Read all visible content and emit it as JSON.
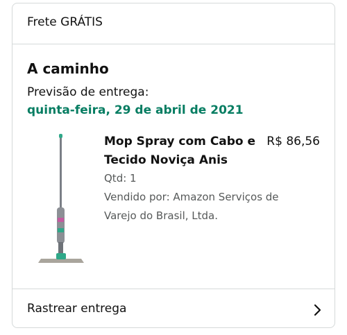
{
  "shipping": {
    "label": "Frete GRÁTIS"
  },
  "delivery": {
    "status": "A caminho",
    "estimate_label": "Previsão de entrega:",
    "estimate_date": "quinta-feira, 29 de abril de 2021"
  },
  "product": {
    "title": "Mop Spray com Cabo e Tecido Noviça Anis",
    "price": "R$ 86,56",
    "quantity": "Qtd: 1",
    "seller": "Vendido por: Amazon Serviços de Varejo do Brasil, Ltda.",
    "image_icon": "spray-mop-image"
  },
  "track": {
    "label": "Rastrear entrega",
    "icon": "chevron-right-icon"
  },
  "colors": {
    "accent_green": "#067d62",
    "border": "#d5d9d9",
    "secondary_text": "#565959"
  }
}
